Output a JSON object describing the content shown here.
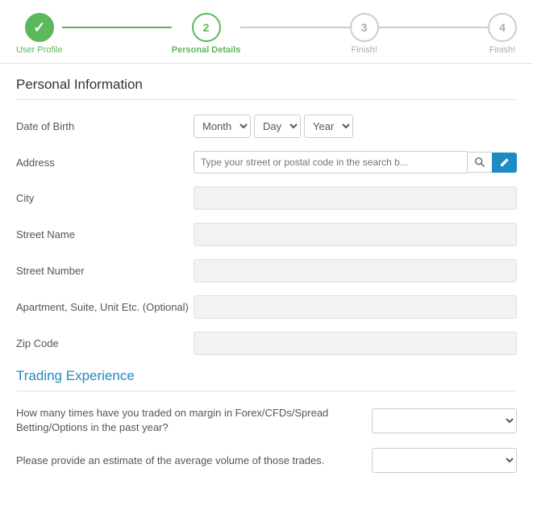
{
  "stepper": {
    "steps": [
      {
        "id": "user-profile",
        "number": "✓",
        "label": "User Profile",
        "state": "completed"
      },
      {
        "id": "personal-details",
        "number": "2",
        "label": "Personal Details",
        "state": "active"
      },
      {
        "id": "finish1",
        "number": "3",
        "label": "Finish!",
        "state": "inactive"
      },
      {
        "id": "finish2",
        "number": "4",
        "label": "Finish!",
        "state": "inactive"
      }
    ]
  },
  "personal_info": {
    "section_title": "Personal Information",
    "fields": {
      "date_of_birth": {
        "label": "Date of Birth",
        "month_placeholder": "Month",
        "day_placeholder": "Day",
        "year_placeholder": "Year"
      },
      "address": {
        "label": "Address",
        "placeholder": "Type your street or postal code in the search b..."
      },
      "city": {
        "label": "City",
        "value": ""
      },
      "street_name": {
        "label": "Street Name",
        "value": ""
      },
      "street_number": {
        "label": "Street Number",
        "value": ""
      },
      "apartment": {
        "label": "Apartment, Suite, Unit Etc. (Optional)",
        "value": ""
      },
      "zip_code": {
        "label": "Zip Code",
        "value": ""
      }
    }
  },
  "trading_experience": {
    "section_title": "Trading Experience",
    "fields": [
      {
        "id": "traded-margin",
        "label": "How many times have you traded on margin in Forex/CFDs/Spread Betting/Options in the past year?"
      },
      {
        "id": "average-volume",
        "label": "Please provide an estimate of the average volume of those trades."
      }
    ]
  }
}
